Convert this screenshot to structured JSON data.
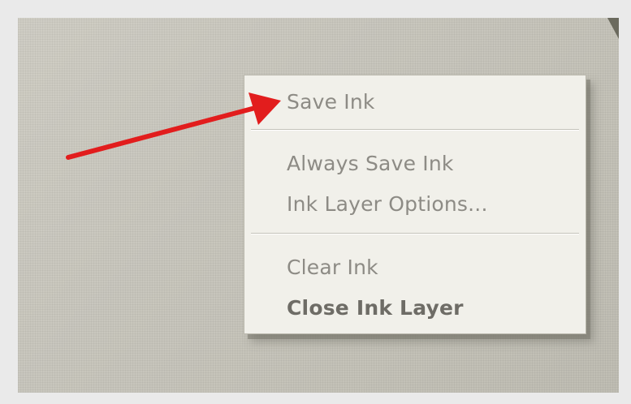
{
  "context_menu": {
    "items": [
      {
        "label": "Save Ink"
      },
      {
        "label": "Always Save Ink"
      },
      {
        "label": "Ink Layer Options..."
      },
      {
        "label": "Clear Ink"
      },
      {
        "label": "Close Ink Layer"
      }
    ]
  },
  "annotation": {
    "arrow_color": "#e21d1d",
    "points_to": "Save Ink"
  },
  "colors": {
    "menu_background": "#f1f0ea",
    "menu_text": "#8d8b85",
    "menu_text_bold": "#6e6c66",
    "desktop_background": "#c8c6bd"
  }
}
